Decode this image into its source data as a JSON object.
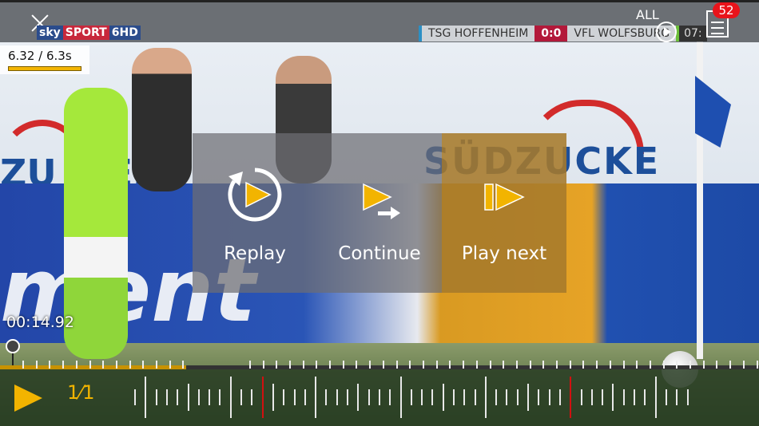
{
  "broadcaster": {
    "logo_sky": "sky",
    "logo_sport": "SPORT",
    "logo_channel": "6HD"
  },
  "scorebug": {
    "home": "TSG HOFFENHEIM",
    "score": "0:0",
    "away": "VFL WOLFSBURG",
    "clock": "07:"
  },
  "topbar": {
    "all_label": "ALL",
    "playlist_count": "52"
  },
  "speed": {
    "label": "6.32 / 6.3s",
    "fill_fraction": 1.0
  },
  "panel": {
    "replay": "Replay",
    "continue": "Continue",
    "play_next": "Play next"
  },
  "timeline": {
    "timecode": "00:14.92",
    "progress_fraction": 0.245
  },
  "playback": {
    "rate": "1⁄1"
  },
  "colors": {
    "accent": "#f2b400",
    "marker": "#d21010",
    "badge": "#e8141b"
  },
  "icons": [
    "close-icon",
    "play-circle-icon",
    "playlist-icon",
    "replay-icon",
    "continue-icon",
    "play-next-icon",
    "play-icon"
  ]
}
